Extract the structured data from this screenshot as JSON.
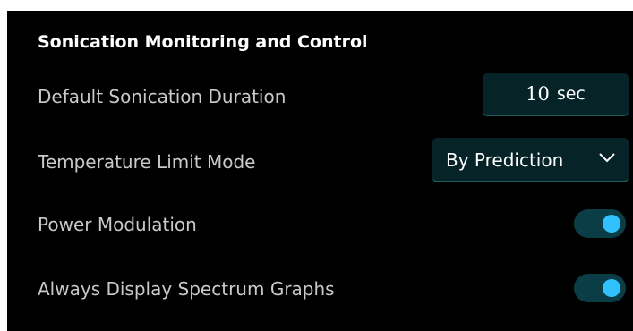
{
  "section": {
    "title": "Sonication Monitoring and Control"
  },
  "settings": {
    "duration": {
      "label": "Default Sonication Duration",
      "value": "10",
      "unit": "sec"
    },
    "temperature_limit_mode": {
      "label": "Temperature Limit Mode",
      "selected": "By Prediction",
      "icon": "chevron-down-icon"
    },
    "power_modulation": {
      "label": "Power Modulation",
      "enabled": true
    },
    "spectrum_graphs": {
      "label": "Always Display Spectrum Graphs",
      "enabled": true
    }
  },
  "colors": {
    "background": "#000000",
    "control_bg": "#062327",
    "toggle_track": "#0a3d46",
    "toggle_knob": "#2fc2ff",
    "label_text": "#c9c9c9",
    "title_text": "#ffffff"
  }
}
